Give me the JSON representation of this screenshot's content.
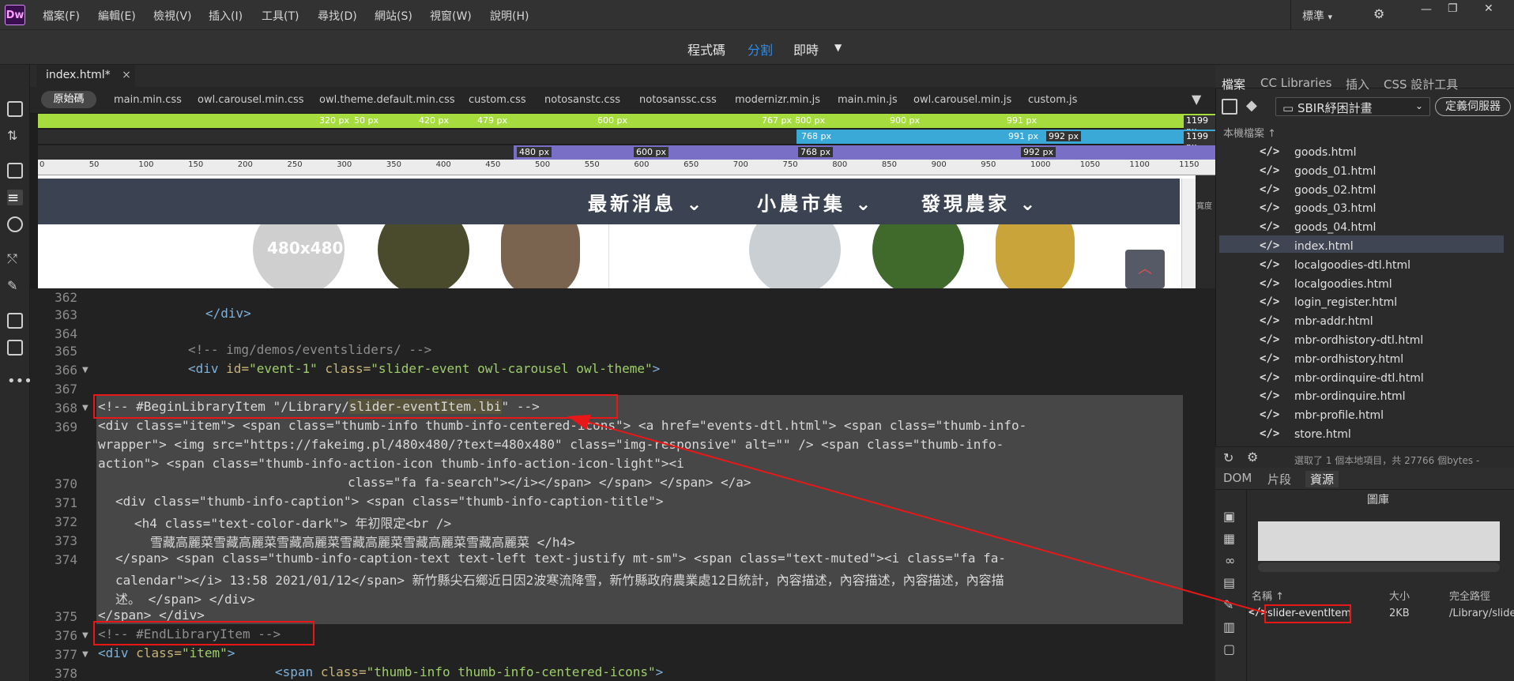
{
  "app": {
    "logo": "Dw"
  },
  "menu": [
    "檔案(F)",
    "編輯(E)",
    "檢視(V)",
    "插入(I)",
    "工具(T)",
    "尋找(D)",
    "網站(S)",
    "視窗(W)",
    "說明(H)"
  ],
  "workspace": {
    "label": "標準",
    "dropdown_glyph": "▾"
  },
  "window_controls": {
    "minimize": "—",
    "restore": "❐",
    "close": "✕"
  },
  "view_modes": {
    "code": "程式碼",
    "split": "分割",
    "live": "即時",
    "dropdown_glyph": "▼"
  },
  "document_tab": {
    "label": "index.html*",
    "close_glyph": "×"
  },
  "related_files": [
    "原始碼",
    "main.min.css",
    "owl.carousel.min.css",
    "owl.theme.default.min.css",
    "custom.css",
    "notosanstc.css",
    "notosanssc.css",
    "modernizr.min.js",
    "main.min.js",
    "owl.carousel.min.js",
    "custom.js"
  ],
  "media_queries": {
    "row1": [
      "320 px",
      "50 px",
      "420 px",
      "479 px",
      "600 px",
      "767 px",
      "800 px",
      "900 px",
      "991 px",
      "1199 px"
    ],
    "row2": [
      "768 px",
      "991 px",
      "992 px",
      "1199 px"
    ],
    "row3": [
      "480 px",
      "600 px",
      "768 px",
      "992 px"
    ]
  },
  "ruler": [
    "0",
    "50",
    "100",
    "150",
    "200",
    "250",
    "300",
    "350",
    "400",
    "450",
    "500",
    "550",
    "600",
    "650",
    "700",
    "750",
    "800",
    "850",
    "900",
    "950",
    "1000",
    "1050",
    "1100",
    "1150"
  ],
  "live_view": {
    "nav": [
      "最新消息 ⌄",
      "小農市集 ⌄",
      "發現農家 ⌄"
    ],
    "placeholder_image": "480x480",
    "width_label": "寬度",
    "scroll_top_glyph": "︿"
  },
  "code": {
    "line_numbers": [
      "362",
      "363",
      "364",
      "365",
      "366",
      "367",
      "368",
      "369",
      "",
      "",
      "370",
      "371",
      "372",
      "373",
      "374",
      "",
      "",
      "375",
      "376",
      "377",
      "378"
    ],
    "l363": "</div>",
    "l365": "<!-- img/demos/eventsliders/ -->",
    "l366_tag": "<div",
    "l366_attr1": "id=",
    "l366_val1": "\"event-1\"",
    "l366_attr2": "class=",
    "l366_val2": "\"slider-event owl-carousel owl-theme\"",
    "l366_end": ">",
    "l368_a": "<!-- #BeginLibraryItem \"/Library/",
    "l368_b": "slider-eventItem.lbi",
    "l368_c": "\" -->",
    "l369_1": "<div class=\"item\"> <span class=\"thumb-info thumb-info-centered-icons\"> <a href=\"events-dtl.html\"> <span class=\"thumb-info-",
    "l369_2": "wrapper\"> <img src=\"https://fakeimg.pl/480x480/?text=480x480\" class=\"img-responsive\" alt=\"\" /> <span class=\"thumb-info-",
    "l369_3": "action\"> <span class=\"thumb-info-action-icon thumb-info-action-icon-light\"><i",
    "l370": "class=\"fa fa-search\"></i></span> </span> </span> </a>",
    "l371": "<div class=\"thumb-info-caption\"> <span class=\"thumb-info-caption-title\">",
    "l372": "<h4 class=\"text-color-dark\"> 年初限定<br />",
    "l373": "雪藏高麗菜雪藏高麗菜雪藏高麗菜雪藏高麗菜雪藏高麗菜雪藏高麗菜 </h4>",
    "l374_1": "</span> <span class=\"thumb-info-caption-text text-left text-justify mt-sm\"> <span class=\"text-muted\"><i class=\"fa fa-",
    "l374_2": "calendar\"></i> 13:58 2021/01/12</span> 新竹縣尖石鄉近日因2波寒流降雪，新竹縣政府農業處12日統計，內容描述，內容描述，內容描述，內容描",
    "l374_3": "述。 </span> </div>",
    "l375": "</span> </div>",
    "l376": "<!-- #EndLibraryItem -->",
    "l377_tag": "<div",
    "l377_attr": "class=",
    "l377_val": "\"item\"",
    "l377_end": ">",
    "l378_tag": "<span",
    "l378_attr": "class=",
    "l378_val": "\"thumb-info thumb-info-centered-icons\"",
    "l378_end": ">"
  },
  "files_panel": {
    "tabs": [
      "檔案",
      "CC Libraries",
      "插入",
      "CSS 設計工具"
    ],
    "site": "SBIR紓困計畫",
    "define_server": "定義伺服器",
    "local_files": "本機檔案 ↑",
    "files": [
      "goods.html",
      "goods_01.html",
      "goods_02.html",
      "goods_03.html",
      "goods_04.html",
      "index.html",
      "localgoodies-dtl.html",
      "localgoodies.html",
      "login_register.html",
      "mbr-addr.html",
      "mbr-ordhistory-dtl.html",
      "mbr-ordhistory.html",
      "mbr-ordinquire-dtl.html",
      "mbr-ordinquire.html",
      "mbr-profile.html",
      "store.html"
    ],
    "status": "選取了 1 個本地項目，共 27766 個bytes -"
  },
  "assets_panel": {
    "tabs": [
      "DOM",
      "片段",
      "資源"
    ],
    "library_title": "圖庫",
    "columns": [
      "名稱 ↑",
      "大小",
      "完全路徑"
    ],
    "item": {
      "name": "slider-eventItem",
      "size": "2KB",
      "path": "/Library/slide..."
    }
  },
  "colors": {
    "accent": "#2d8ceb",
    "highlight_box": "#e81818",
    "mq_green": "#a7dc3f",
    "mq_blue": "#3ba9d8",
    "mq_purple": "#7a6fc7"
  }
}
